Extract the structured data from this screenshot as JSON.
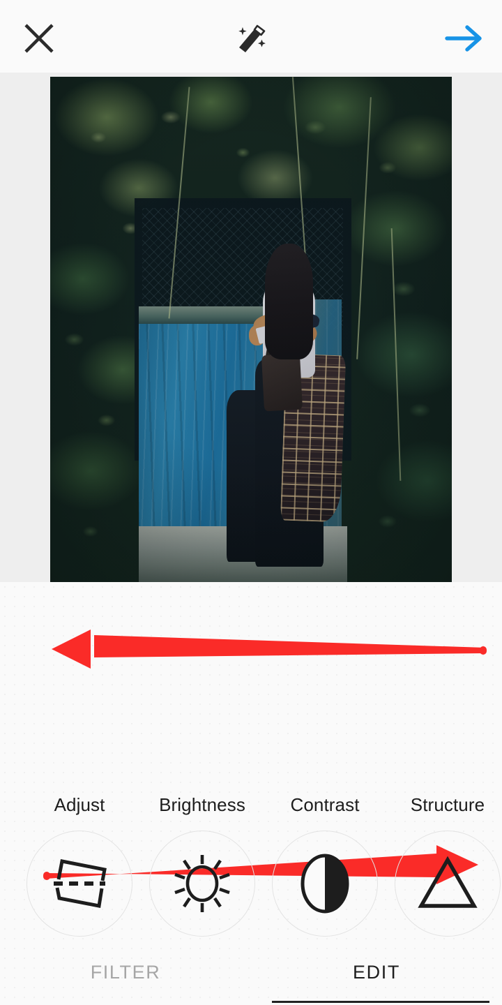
{
  "app": {
    "name": "photo-editor",
    "accent_blue": "#1793e6",
    "annotation_red": "#fa2b28",
    "panel_background": "#fafafa",
    "stage_background": "#eeeeee"
  },
  "topbar": {
    "close_label": "close-icon",
    "close_title": "Close",
    "wand_label": "magic-wand-icon",
    "wand_title": "Auto enhance",
    "next_label": "arrow-right-icon",
    "next_title": "Next"
  },
  "photo": {
    "alt": "Woman in white ringer tee and plaid shirt tied at waist standing by a weathered blue door surrounded by green foliage"
  },
  "annotations": [
    {
      "name": "red-arrow-left",
      "direction": "left",
      "color": "#fa2b28"
    },
    {
      "name": "red-arrow-right",
      "direction": "right",
      "color": "#fa2b28"
    }
  ],
  "tools": [
    {
      "label": "Adjust",
      "icon": "perspective-icon"
    },
    {
      "label": "Brightness",
      "icon": "sun-icon"
    },
    {
      "label": "Contrast",
      "icon": "half-circle-icon"
    },
    {
      "label": "Structure",
      "icon": "triangle-icon"
    }
  ],
  "tabs": [
    {
      "label": "FILTER",
      "active": false
    },
    {
      "label": "EDIT",
      "active": true
    }
  ]
}
